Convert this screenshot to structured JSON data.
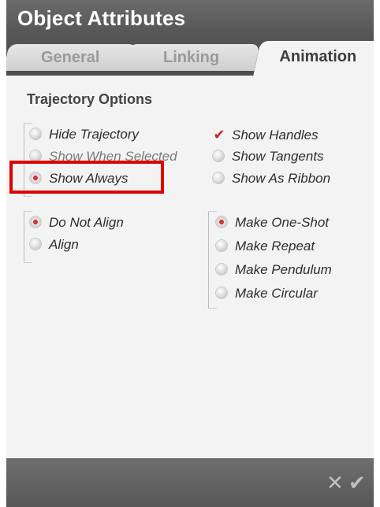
{
  "dialog": {
    "title": "Object Attributes"
  },
  "tabs": [
    {
      "label": "General",
      "active": false
    },
    {
      "label": "Linking",
      "active": false
    },
    {
      "label": "Animation",
      "active": true
    }
  ],
  "trajectory": {
    "section_title": "Trajectory Options",
    "visibility_options": [
      {
        "label": "Hide Trajectory",
        "selected": false
      },
      {
        "label": "Show When Selected",
        "selected": false
      },
      {
        "label": "Show Always",
        "selected": true
      }
    ],
    "display_options": [
      {
        "label": "Show Handles",
        "checked": true
      },
      {
        "label": "Show Tangents",
        "checked": false
      },
      {
        "label": "Show As Ribbon",
        "checked": false
      }
    ],
    "align_options": [
      {
        "label": "Do Not Align",
        "selected": true
      },
      {
        "label": "Align",
        "selected": false
      }
    ],
    "shot_options": [
      {
        "label": "Make One-Shot",
        "selected": true
      },
      {
        "label": "Make Repeat",
        "selected": false
      },
      {
        "label": "Make Pendulum",
        "selected": false
      },
      {
        "label": "Make Circular",
        "selected": false
      }
    ]
  },
  "footer": {
    "cancel_icon": "close-icon",
    "confirm_icon": "checkmark-icon"
  },
  "colors": {
    "accent": "#c63838",
    "highlight_box": "#e00000",
    "header_bg": "#565656"
  }
}
